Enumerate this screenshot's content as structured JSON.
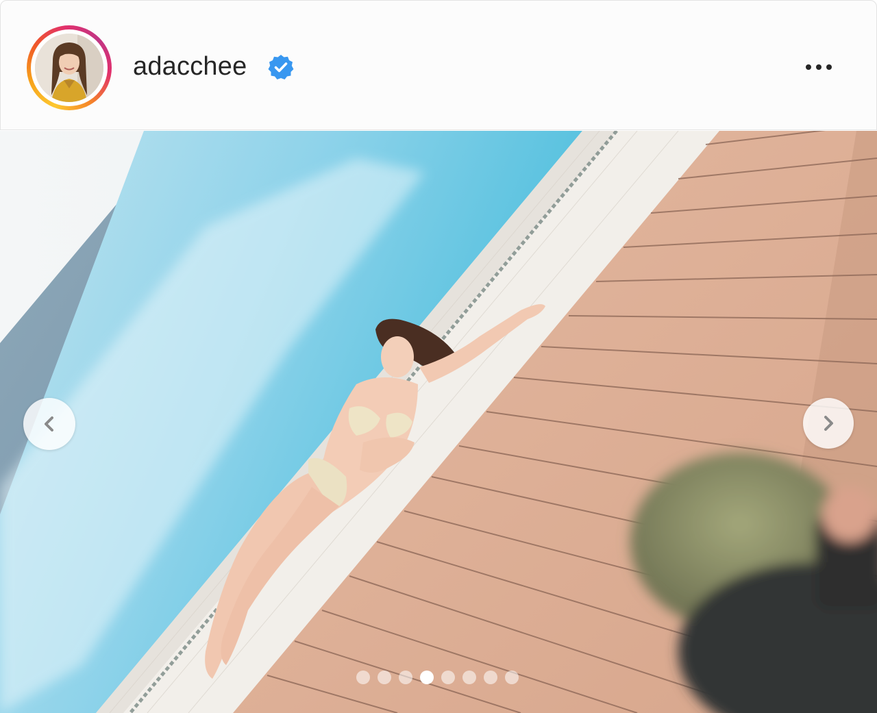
{
  "post": {
    "username": "adacchee",
    "verified": true,
    "avatar": "profile-photo",
    "more_icon": "more-horizontal-icon"
  },
  "carousel": {
    "prev_icon": "chevron-left-icon",
    "next_icon": "chevron-right-icon",
    "total_slides": 8,
    "active_slide": 4
  },
  "colors": {
    "story_ring_start": "#fdc830",
    "story_ring_end": "#c13584",
    "verified_badge": "#3897f0",
    "text": "#262626"
  }
}
